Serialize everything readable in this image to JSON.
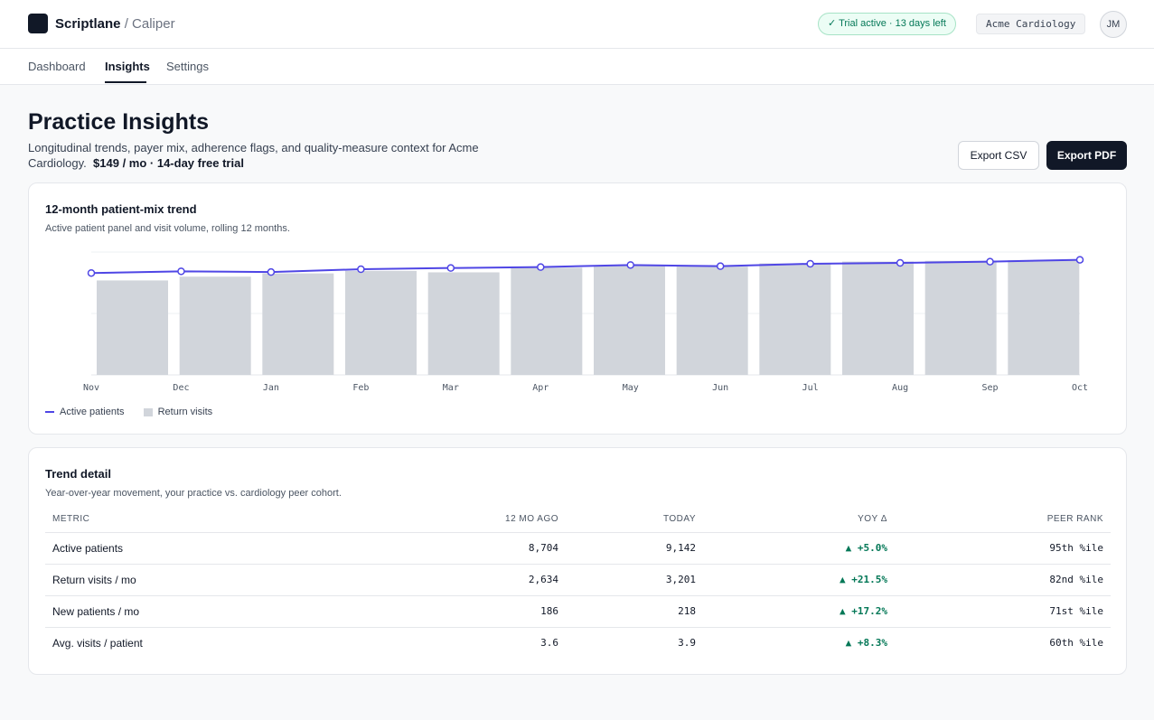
{
  "header": {
    "brand": "Scriptlane",
    "separator": "/",
    "product": "Caliper",
    "trial_badge": "✓ Trial active · 13 days left",
    "org": "Acme Cardiology",
    "avatar_initials": "JM"
  },
  "tabs": [
    {
      "label": "Dashboard",
      "active": false
    },
    {
      "label": "Insights",
      "active": true
    },
    {
      "label": "Settings",
      "active": false
    }
  ],
  "page": {
    "title": "Practice Insights",
    "subtitle": "Longitudinal trends, payer mix, adherence flags, and quality-measure context for Acme Cardiology.",
    "pricing": "$149 / mo · 14-day free trial",
    "export_csv": "Export CSV",
    "export_pdf": "Export PDF"
  },
  "trend_card": {
    "title": "12-month patient-mix trend",
    "subtitle": "Active patient panel and visit volume, rolling 12 months.",
    "legend_line": "Active patients",
    "legend_bar": "Return visits"
  },
  "chart_data": {
    "type": "bar",
    "categories": [
      "Nov",
      "Dec",
      "Jan",
      "Feb",
      "Mar",
      "Apr",
      "May",
      "Jun",
      "Jul",
      "Aug",
      "Sep",
      "Oct"
    ],
    "series": [
      {
        "name": "Return visits",
        "type": "bar",
        "values": [
          2634,
          2740,
          2830,
          2900,
          2860,
          2990,
          3050,
          3020,
          3110,
          3160,
          3180,
          3201
        ]
      },
      {
        "name": "Active patients",
        "type": "line",
        "values": [
          8704,
          8760,
          8735,
          8830,
          8870,
          8900,
          8970,
          8930,
          9010,
          9040,
          9080,
          9142
        ]
      }
    ],
    "grid": true,
    "legend": "bottom-left",
    "colors": {
      "line": "#4f46e5",
      "bar": "#d1d5db"
    }
  },
  "detail_card": {
    "title": "Trend detail",
    "subtitle": "Year-over-year movement, your practice vs. cardiology peer cohort.",
    "columns": [
      "METRIC",
      "12 MO AGO",
      "TODAY",
      "YOY Δ",
      "PEER RANK"
    ],
    "rows": [
      {
        "metric": "Active patients",
        "ago": "8,704",
        "today": "9,142",
        "yoy": "▲ +5.0%",
        "rank": "95th %ile"
      },
      {
        "metric": "Return visits / mo",
        "ago": "2,634",
        "today": "3,201",
        "yoy": "▲ +21.5%",
        "rank": "82nd %ile"
      },
      {
        "metric": "New patients / mo",
        "ago": "186",
        "today": "218",
        "yoy": "▲ +17.2%",
        "rank": "71st %ile"
      },
      {
        "metric": "Avg. visits / patient",
        "ago": "3.6",
        "today": "3.9",
        "yoy": "▲ +8.3%",
        "rank": "60th %ile"
      }
    ]
  }
}
